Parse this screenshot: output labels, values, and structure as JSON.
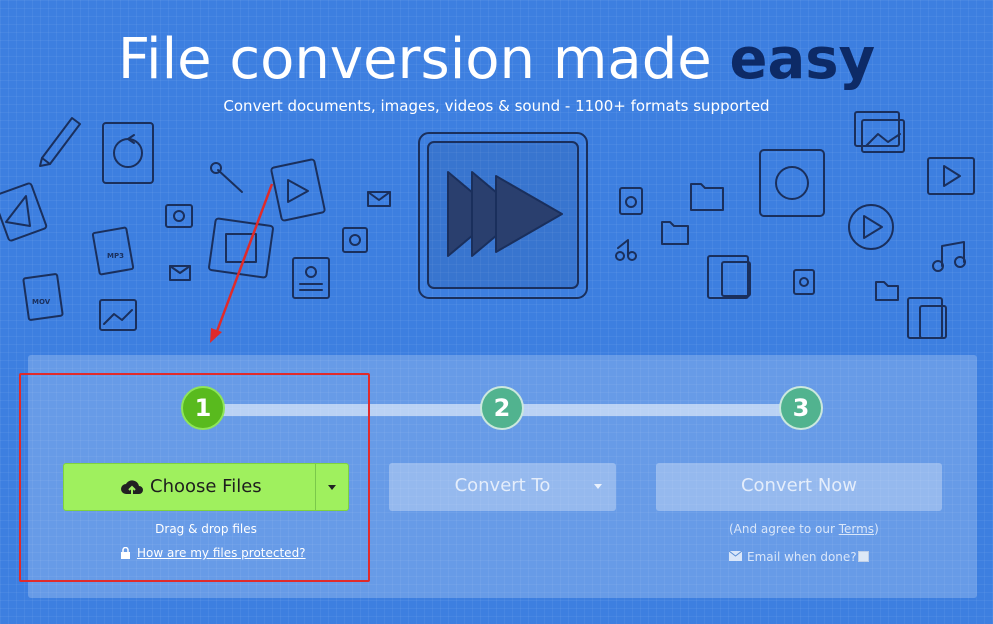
{
  "hero": {
    "title_main": "File conversion made ",
    "title_emphasis": "easy",
    "subtitle": "Convert documents, images, videos & sound - 1100+ formats supported",
    "doodle_labels": {
      "mp3": "MP3",
      "mov": "MOV"
    }
  },
  "steps": [
    {
      "number": "1",
      "state": "active"
    },
    {
      "number": "2",
      "state": "inactive"
    },
    {
      "number": "3",
      "state": "inactive"
    }
  ],
  "choose": {
    "button_label": "Choose Files",
    "icon": "cloud-upload-icon",
    "drag_text": "Drag & drop files",
    "protection_link": "How are my files protected?",
    "protection_icon": "lock-icon"
  },
  "convert_to": {
    "label": "Convert To"
  },
  "convert_now": {
    "label": "Convert Now",
    "agree_prefix": "(And agree to our ",
    "terms_link": "Terms",
    "agree_suffix": ")",
    "email_label": "Email when done?",
    "email_icon": "envelope-icon"
  },
  "colors": {
    "background": "#3d7fe0",
    "title_emphasis": "#0d2a66",
    "choose_button": "#9ff05e",
    "step_active": "#59ba1e",
    "step_inactive": "#51b38f",
    "annotation": "#e02a2a"
  }
}
